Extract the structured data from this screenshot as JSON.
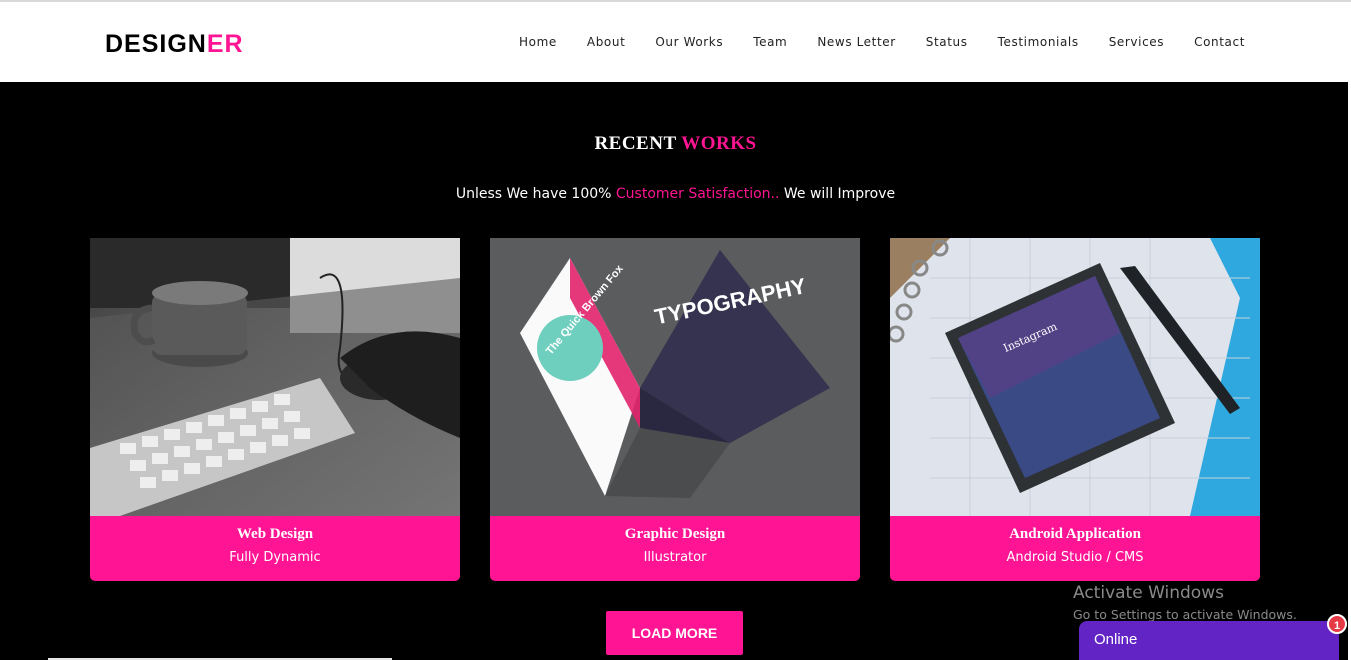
{
  "header": {
    "logo_main": "DESIGN",
    "logo_accent": "ER",
    "nav": [
      {
        "label": "Home"
      },
      {
        "label": "About"
      },
      {
        "label": "Our Works"
      },
      {
        "label": "Team"
      },
      {
        "label": "News Letter"
      },
      {
        "label": "Status"
      },
      {
        "label": "Testimonials"
      },
      {
        "label": "Services"
      },
      {
        "label": "Contact"
      }
    ]
  },
  "section": {
    "title_main": "RECENT",
    "title_accent": "WORKS",
    "subtitle_pre": "Unless We have 100%",
    "subtitle_accent": "Customer Satisfaction..",
    "subtitle_post": "We will Improve"
  },
  "cards": [
    {
      "title": "Web Design",
      "subtitle": "Fully Dynamic",
      "image": "keyboard-mouse-photo"
    },
    {
      "title": "Graphic Design",
      "subtitle": "Illustrator",
      "image": "typography-brochure-photo",
      "image_text": [
        "The Quick Brown Fox",
        "TYPOGRAPHY"
      ]
    },
    {
      "title": "Android Application",
      "subtitle": "Android Studio / CMS",
      "image": "phone-notebook-photo",
      "image_text": "Instagram"
    }
  ],
  "load_more_label": "LOAD MORE",
  "watermark": {
    "title": "Activate Windows",
    "subtitle": "Go to Settings to activate Windows."
  },
  "chat": {
    "label": "Online",
    "badge": "1"
  },
  "colors": {
    "accent": "#ff1493",
    "background": "#000000",
    "chat": "#6224c4",
    "badge": "#e53945"
  }
}
